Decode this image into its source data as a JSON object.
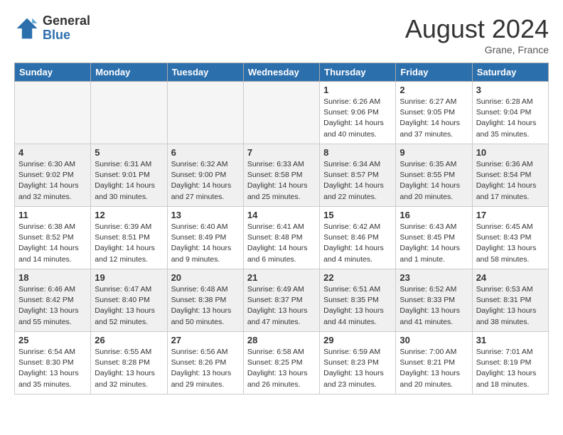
{
  "header": {
    "logo_general": "General",
    "logo_blue": "Blue",
    "month_title": "August 2024",
    "location": "Grane, France"
  },
  "weekdays": [
    "Sunday",
    "Monday",
    "Tuesday",
    "Wednesday",
    "Thursday",
    "Friday",
    "Saturday"
  ],
  "weeks": [
    [
      {
        "day": "",
        "info": ""
      },
      {
        "day": "",
        "info": ""
      },
      {
        "day": "",
        "info": ""
      },
      {
        "day": "",
        "info": ""
      },
      {
        "day": "1",
        "info": "Sunrise: 6:26 AM\nSunset: 9:06 PM\nDaylight: 14 hours\nand 40 minutes."
      },
      {
        "day": "2",
        "info": "Sunrise: 6:27 AM\nSunset: 9:05 PM\nDaylight: 14 hours\nand 37 minutes."
      },
      {
        "day": "3",
        "info": "Sunrise: 6:28 AM\nSunset: 9:04 PM\nDaylight: 14 hours\nand 35 minutes."
      }
    ],
    [
      {
        "day": "4",
        "info": "Sunrise: 6:30 AM\nSunset: 9:02 PM\nDaylight: 14 hours\nand 32 minutes."
      },
      {
        "day": "5",
        "info": "Sunrise: 6:31 AM\nSunset: 9:01 PM\nDaylight: 14 hours\nand 30 minutes."
      },
      {
        "day": "6",
        "info": "Sunrise: 6:32 AM\nSunset: 9:00 PM\nDaylight: 14 hours\nand 27 minutes."
      },
      {
        "day": "7",
        "info": "Sunrise: 6:33 AM\nSunset: 8:58 PM\nDaylight: 14 hours\nand 25 minutes."
      },
      {
        "day": "8",
        "info": "Sunrise: 6:34 AM\nSunset: 8:57 PM\nDaylight: 14 hours\nand 22 minutes."
      },
      {
        "day": "9",
        "info": "Sunrise: 6:35 AM\nSunset: 8:55 PM\nDaylight: 14 hours\nand 20 minutes."
      },
      {
        "day": "10",
        "info": "Sunrise: 6:36 AM\nSunset: 8:54 PM\nDaylight: 14 hours\nand 17 minutes."
      }
    ],
    [
      {
        "day": "11",
        "info": "Sunrise: 6:38 AM\nSunset: 8:52 PM\nDaylight: 14 hours\nand 14 minutes."
      },
      {
        "day": "12",
        "info": "Sunrise: 6:39 AM\nSunset: 8:51 PM\nDaylight: 14 hours\nand 12 minutes."
      },
      {
        "day": "13",
        "info": "Sunrise: 6:40 AM\nSunset: 8:49 PM\nDaylight: 14 hours\nand 9 minutes."
      },
      {
        "day": "14",
        "info": "Sunrise: 6:41 AM\nSunset: 8:48 PM\nDaylight: 14 hours\nand 6 minutes."
      },
      {
        "day": "15",
        "info": "Sunrise: 6:42 AM\nSunset: 8:46 PM\nDaylight: 14 hours\nand 4 minutes."
      },
      {
        "day": "16",
        "info": "Sunrise: 6:43 AM\nSunset: 8:45 PM\nDaylight: 14 hours\nand 1 minute."
      },
      {
        "day": "17",
        "info": "Sunrise: 6:45 AM\nSunset: 8:43 PM\nDaylight: 13 hours\nand 58 minutes."
      }
    ],
    [
      {
        "day": "18",
        "info": "Sunrise: 6:46 AM\nSunset: 8:42 PM\nDaylight: 13 hours\nand 55 minutes."
      },
      {
        "day": "19",
        "info": "Sunrise: 6:47 AM\nSunset: 8:40 PM\nDaylight: 13 hours\nand 52 minutes."
      },
      {
        "day": "20",
        "info": "Sunrise: 6:48 AM\nSunset: 8:38 PM\nDaylight: 13 hours\nand 50 minutes."
      },
      {
        "day": "21",
        "info": "Sunrise: 6:49 AM\nSunset: 8:37 PM\nDaylight: 13 hours\nand 47 minutes."
      },
      {
        "day": "22",
        "info": "Sunrise: 6:51 AM\nSunset: 8:35 PM\nDaylight: 13 hours\nand 44 minutes."
      },
      {
        "day": "23",
        "info": "Sunrise: 6:52 AM\nSunset: 8:33 PM\nDaylight: 13 hours\nand 41 minutes."
      },
      {
        "day": "24",
        "info": "Sunrise: 6:53 AM\nSunset: 8:31 PM\nDaylight: 13 hours\nand 38 minutes."
      }
    ],
    [
      {
        "day": "25",
        "info": "Sunrise: 6:54 AM\nSunset: 8:30 PM\nDaylight: 13 hours\nand 35 minutes."
      },
      {
        "day": "26",
        "info": "Sunrise: 6:55 AM\nSunset: 8:28 PM\nDaylight: 13 hours\nand 32 minutes."
      },
      {
        "day": "27",
        "info": "Sunrise: 6:56 AM\nSunset: 8:26 PM\nDaylight: 13 hours\nand 29 minutes."
      },
      {
        "day": "28",
        "info": "Sunrise: 6:58 AM\nSunset: 8:25 PM\nDaylight: 13 hours\nand 26 minutes."
      },
      {
        "day": "29",
        "info": "Sunrise: 6:59 AM\nSunset: 8:23 PM\nDaylight: 13 hours\nand 23 minutes."
      },
      {
        "day": "30",
        "info": "Sunrise: 7:00 AM\nSunset: 8:21 PM\nDaylight: 13 hours\nand 20 minutes."
      },
      {
        "day": "31",
        "info": "Sunrise: 7:01 AM\nSunset: 8:19 PM\nDaylight: 13 hours\nand 18 minutes."
      }
    ]
  ]
}
